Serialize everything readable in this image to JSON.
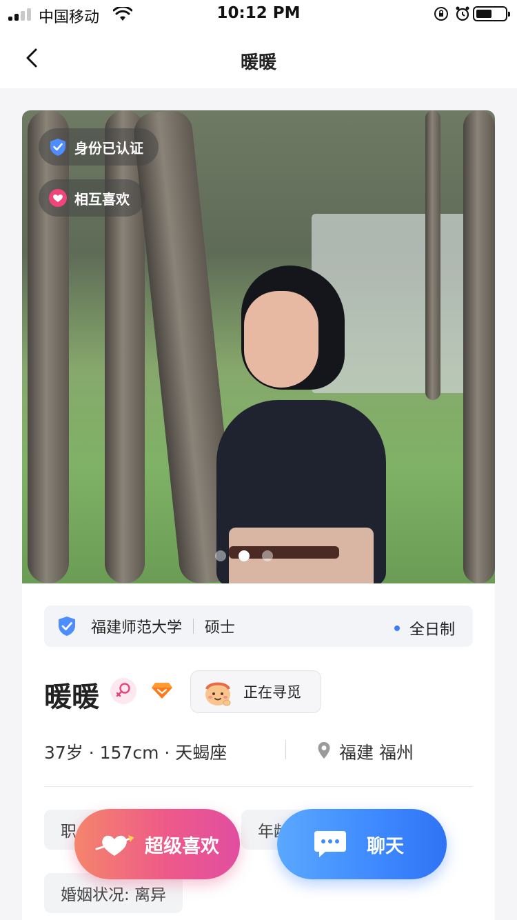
{
  "status_bar": {
    "carrier": "中国移动",
    "time": "10:12 PM"
  },
  "nav": {
    "title": "暖暖"
  },
  "photo": {
    "badges": {
      "verified": "身份已认证",
      "mutual": "相互喜欢"
    },
    "page_count": 3,
    "active_page": 2
  },
  "education": {
    "school": "福建师范大学",
    "degree": "硕士",
    "mode": "全日制"
  },
  "profile": {
    "name": "暖暖",
    "seeking": "正在寻觅",
    "basic_info": "37岁 · 157cm · 天蝎座",
    "location": "福建 福州"
  },
  "tags": {
    "job": "职",
    "year": "年龄",
    "marital": "婚姻状况:  离异"
  },
  "actions": {
    "super_like": "超级喜欢",
    "chat": "聊天"
  },
  "colors": {
    "accent_blue": "#3f8bff",
    "accent_pink": "#ee5a88",
    "female_pink": "#e8447e"
  }
}
